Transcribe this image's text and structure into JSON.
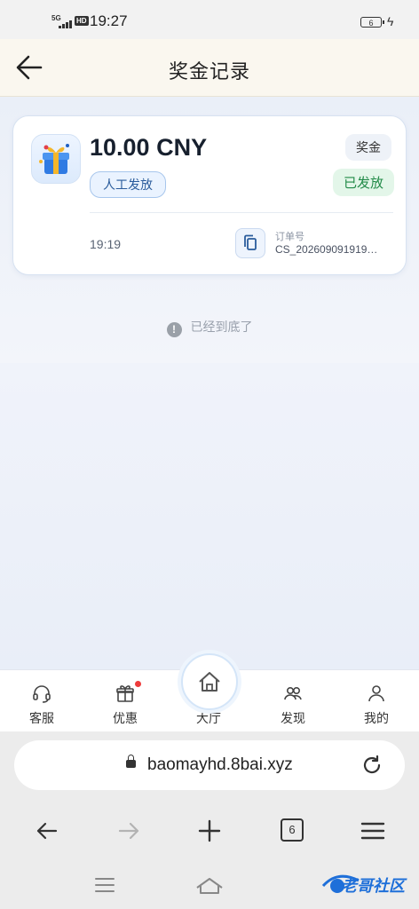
{
  "status_bar": {
    "network": "5G",
    "hd": "HD",
    "time": "19:27",
    "battery": "6"
  },
  "header": {
    "title": "奖金记录"
  },
  "record": {
    "amount": "10.00 CNY",
    "type_tag": "奖金",
    "method_tag": "人工发放",
    "status_tag": "已发放",
    "time": "19:19",
    "order_label": "订单号",
    "order_number": "CS_202609091919…"
  },
  "end_note": "已经到底了",
  "bottom_nav": {
    "items": [
      {
        "label": "客服",
        "icon": "headset-icon"
      },
      {
        "label": "优惠",
        "icon": "gift-icon"
      },
      {
        "label": "大厅",
        "icon": "home-icon"
      },
      {
        "label": "发现",
        "icon": "people-icon"
      },
      {
        "label": "我的",
        "icon": "user-icon"
      }
    ]
  },
  "browser": {
    "url": "baomayhd.8bai.xyz",
    "tab_count": "6"
  },
  "watermark": {
    "text": "老哥社区"
  },
  "colors": {
    "accent": "#2a5c9c",
    "status_green": "#218a47",
    "header_bg": "#faf7ef"
  }
}
